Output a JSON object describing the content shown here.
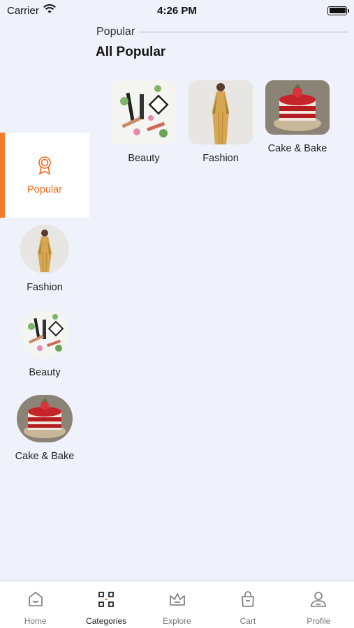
{
  "status_bar": {
    "carrier": "Carrier",
    "time": "4:26 PM"
  },
  "header": {
    "section_label": "Popular",
    "title": "All Popular"
  },
  "sidebar": {
    "items": [
      {
        "label": "Popular",
        "icon": "award-icon",
        "active": true
      },
      {
        "label": "Fashion",
        "icon": "fashion-image"
      },
      {
        "label": "Beauty",
        "icon": "beauty-image"
      },
      {
        "label": "Cake & Bake",
        "icon": "cake-image"
      }
    ]
  },
  "grid": {
    "items": [
      {
        "label": "Beauty",
        "icon": "beauty-image"
      },
      {
        "label": "Fashion",
        "icon": "fashion-image"
      },
      {
        "label": "Cake & Bake",
        "icon": "cake-image"
      }
    ]
  },
  "tabbar": {
    "items": [
      {
        "label": "Home",
        "icon": "home-icon"
      },
      {
        "label": "Categories",
        "icon": "categories-icon",
        "active": true
      },
      {
        "label": "Explore",
        "icon": "crown-icon"
      },
      {
        "label": "Cart",
        "icon": "bag-icon"
      },
      {
        "label": "Profile",
        "icon": "user-icon"
      }
    ]
  },
  "colors": {
    "accent": "#f47a2e",
    "background": "#eff2fa"
  }
}
